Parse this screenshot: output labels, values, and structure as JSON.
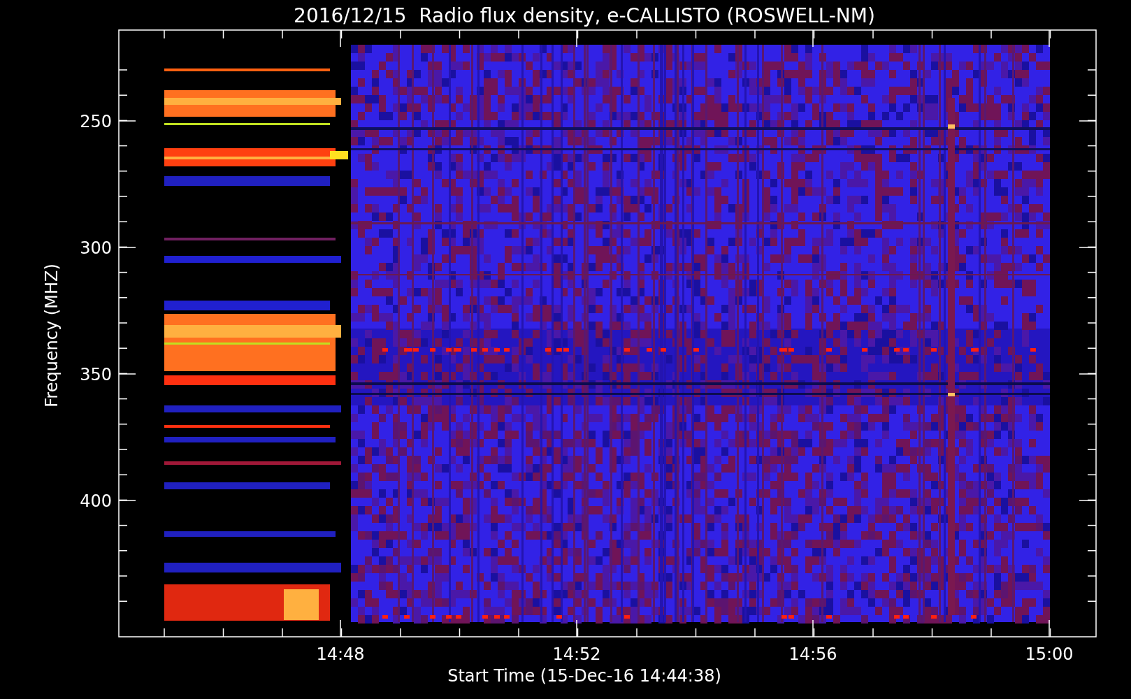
{
  "title": "2016/12/15  Radio flux density, e-CALLISTO (ROSWELL-NM)",
  "ylabel": "Frequency (MHZ)",
  "xlabel": "Start Time (15-Dec-16 14:44:38)",
  "yticks": [
    "250",
    "300",
    "350",
    "400"
  ],
  "xticks": [
    "14:48",
    "14:52",
    "14:56",
    "15:00"
  ]
}
